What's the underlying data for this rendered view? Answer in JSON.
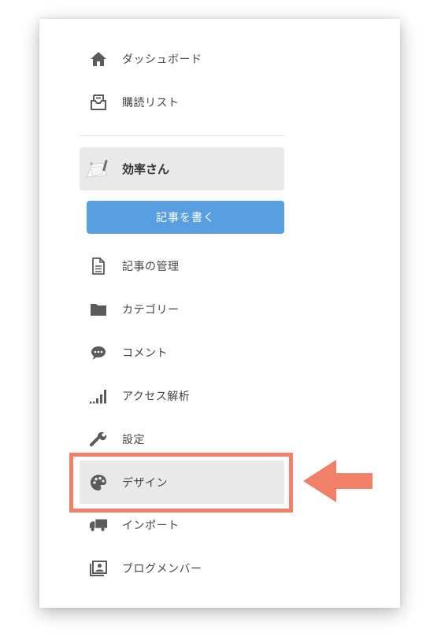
{
  "nav_top": [
    {
      "id": "dashboard",
      "label": "ダッシュボード",
      "icon": "home-icon"
    },
    {
      "id": "reading-list",
      "label": "購読リスト",
      "icon": "reading-list-icon"
    }
  ],
  "blog": {
    "name": "効率さん",
    "avatar": "blog-avatar"
  },
  "write_button": {
    "label": "記事を書く",
    "color": "#579fe0"
  },
  "nav_blog": [
    {
      "id": "manage-entries",
      "label": "記事の管理",
      "icon": "document-icon"
    },
    {
      "id": "categories",
      "label": "カテゴリー",
      "icon": "folder-icon"
    },
    {
      "id": "comments",
      "label": "コメント",
      "icon": "speech-bubble-icon"
    },
    {
      "id": "analytics",
      "label": "アクセス解析",
      "icon": "bar-signal-icon"
    },
    {
      "id": "settings",
      "label": "設定",
      "icon": "wrench-icon"
    },
    {
      "id": "design",
      "label": "デザイン",
      "icon": "palette-icon",
      "active": true
    },
    {
      "id": "import",
      "label": "インポート",
      "icon": "truck-icon"
    },
    {
      "id": "members",
      "label": "ブログメンバー",
      "icon": "member-card-icon"
    }
  ],
  "annotation": {
    "highlight_color": "#f28068",
    "target": "design"
  }
}
